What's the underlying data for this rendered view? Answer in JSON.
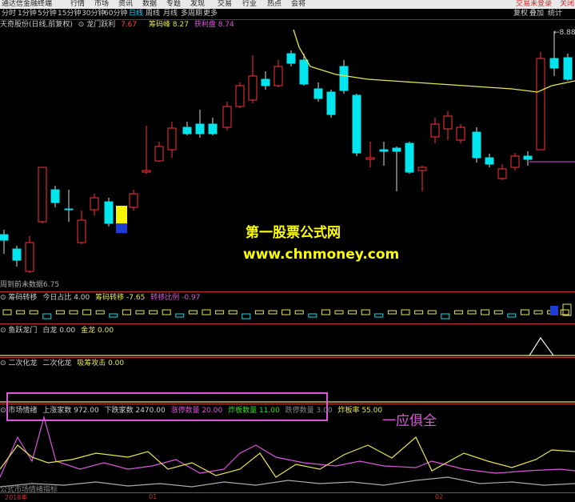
{
  "menubar": {
    "items": [
      "通达信金融终端",
      "行情",
      "市场",
      "资讯",
      "数据",
      "专题",
      "发现",
      "交易",
      "行业",
      "热点",
      "会将"
    ],
    "right_text": "交易未登录",
    "right_text2": "关闭"
  },
  "periodbar": {
    "periods": [
      "分时",
      "1分钟",
      "5分钟",
      "15分钟",
      "30分钟",
      "60分钟",
      "日线",
      "周线",
      "月线",
      "多周期",
      "更多"
    ],
    "active": "日线",
    "right_buttons": [
      "复权",
      "叠加",
      "统计"
    ]
  },
  "main_panel": {
    "title": "天奇股份(日线,前复权)",
    "indicator": "龙门跃利",
    "indicator_value": "7.67",
    "chip_label": "筹码峰",
    "chip_value": "8.27",
    "profit_label": "获利盘",
    "profit_value": "8.74",
    "high_label": "8.88",
    "low_label_prefix": "周到前未数据",
    "low_value": "6.75",
    "watermark_line1": "第一股票公式网",
    "watermark_line2": "www.chnmoney.com"
  },
  "panel2": {
    "name": "筹码转移",
    "fields": [
      {
        "label": "今日占比",
        "value": "4.00"
      },
      {
        "label": "筹码转移",
        "value": "-7.65"
      },
      {
        "label": "转移比例",
        "value": "-0.97"
      }
    ]
  },
  "panel3": {
    "name": "鱼跃龙门",
    "fields": [
      {
        "label": "白龙",
        "value": "0.00"
      },
      {
        "label": "金龙",
        "value": "0.00"
      }
    ]
  },
  "panel4": {
    "name": "二次化龙",
    "fields": [
      {
        "label": "二次化龙",
        "value": ""
      },
      {
        "label": "吸筹攻击",
        "value": "0.00"
      }
    ]
  },
  "panel5": {
    "name": "市场情绪",
    "fields": [
      {
        "label": "上涨家数",
        "value": "972.00"
      },
      {
        "label": "下跌家数",
        "value": "2470.00"
      },
      {
        "label": "涨停数量",
        "value": "20.00"
      },
      {
        "label": "炸板数量",
        "value": "11.00"
      },
      {
        "label": "跌停数量",
        "value": "3.00"
      },
      {
        "label": "炸板率",
        "value": "55.00"
      }
    ],
    "note": "一应俱全",
    "footer": "公式市场情绪指标",
    "date_labels": [
      "2018年",
      "01",
      "02"
    ]
  },
  "colors": {
    "up": "#ff3232",
    "down": "#00e5ee",
    "ma": "#e6e650",
    "bg": "#000000",
    "accent": "#dd55dd",
    "grid": "#b33333"
  }
}
